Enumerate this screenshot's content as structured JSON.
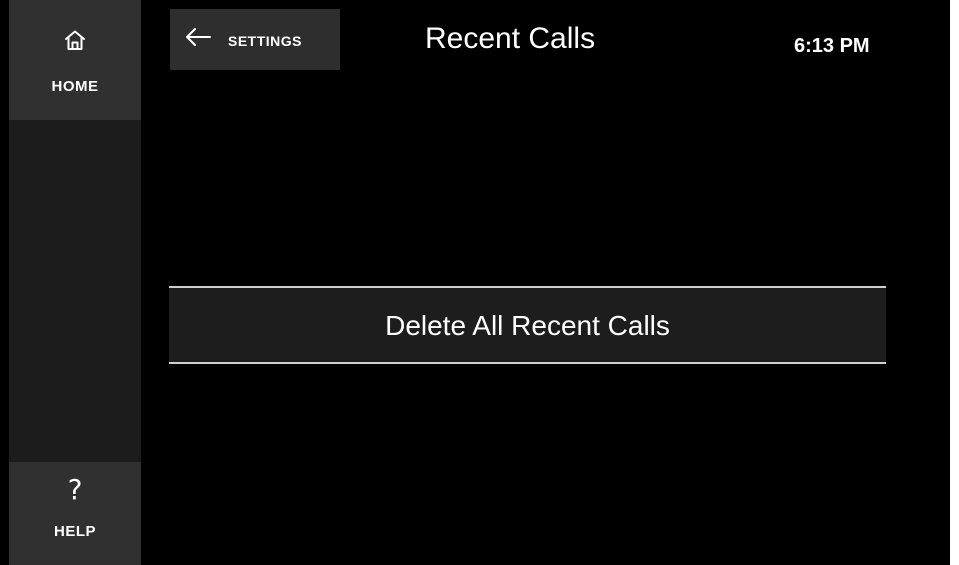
{
  "sidebar": {
    "home": {
      "label": "HOME",
      "icon": "home-icon"
    },
    "help": {
      "label": "HELP",
      "icon": "question-mark-icon",
      "glyph": "?"
    }
  },
  "header": {
    "back_label": "SETTINGS",
    "back_icon": "arrow-left-icon",
    "title": "Recent Calls",
    "time": "6:13 PM"
  },
  "main": {
    "delete_all_label": "Delete All Recent Calls"
  },
  "colors": {
    "background": "#000000",
    "rail": "#1c1c1c",
    "rail_button": "#2f302f",
    "button_fill": "#1c1d1c",
    "button_border": "#cfcfcf",
    "text": "#ffffff"
  }
}
